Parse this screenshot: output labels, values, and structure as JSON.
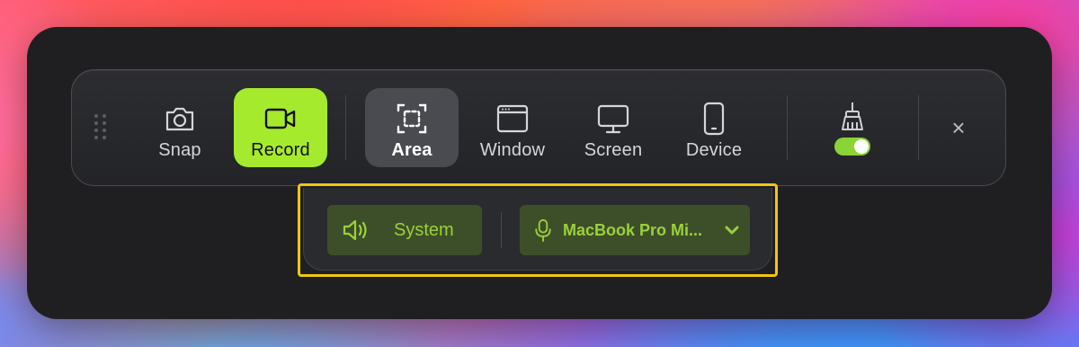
{
  "toolbar": {
    "tools": [
      {
        "id": "snap",
        "label": "Snap",
        "icon": "camera-icon"
      },
      {
        "id": "record",
        "label": "Record",
        "icon": "video-camera-icon",
        "selected": true
      },
      {
        "id": "area",
        "label": "Area",
        "icon": "area-select-icon",
        "selected": true
      },
      {
        "id": "window",
        "label": "Window",
        "icon": "window-icon"
      },
      {
        "id": "screen",
        "label": "Screen",
        "icon": "monitor-icon"
      },
      {
        "id": "device",
        "label": "Device",
        "icon": "phone-icon"
      }
    ],
    "clean_toggle": {
      "icon": "broom-icon",
      "on": true
    },
    "close_icon": "close-icon",
    "close_glyph": "×"
  },
  "audio": {
    "system_label": "System",
    "mic_label": "MacBook Pro Mi...",
    "system_icon": "speaker-icon",
    "mic_icon": "microphone-icon",
    "dropdown_icon": "chevron-down-icon"
  },
  "colors": {
    "accent": "#a6ea2d",
    "audio_pill_bg": "#3d4f29",
    "audio_pill_text": "#9bd13a",
    "highlight_border": "#f2c511",
    "toggle_on": "#8bd336"
  }
}
